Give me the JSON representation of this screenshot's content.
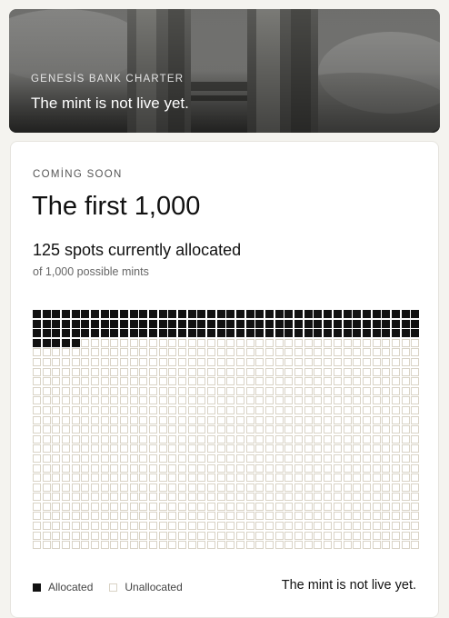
{
  "hero": {
    "kicker": "GENESİS BANK CHARTER",
    "headline": "The mint is not live yet."
  },
  "card": {
    "eyebrow": "COMİNG SOON",
    "title": "The first 1,000",
    "stat": "125 spots currently allocated",
    "sub": "of 1,000 possible mints"
  },
  "grid": {
    "allocated": 125,
    "total": 1000,
    "allocated_color": "#111111",
    "unallocated_border": "#d9d3c6"
  },
  "legend": {
    "allocated_label": "Allocated",
    "unallocated_label": "Unallocated"
  },
  "status": "The mint is not live yet."
}
